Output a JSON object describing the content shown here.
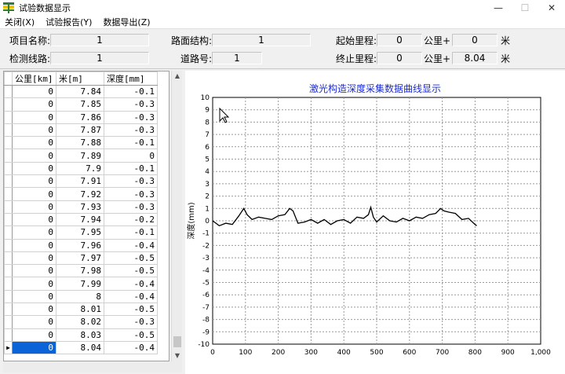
{
  "window": {
    "title": "试验数据显示",
    "minimize": "—",
    "maximize": "☐",
    "close": "✕"
  },
  "menu": [
    "关闭(X)",
    "试验报告(Y)",
    "数据导出(Z)"
  ],
  "info": {
    "project_name_label": "项目名称:",
    "project_name": "1",
    "line_label": "检测线路:",
    "line": "1",
    "pavement_label": "路面结构:",
    "pavement": "1",
    "lane_label": "道路号:",
    "lane": "1",
    "start_label": "起始里程:",
    "start_km": "0",
    "km_unit": "公里+",
    "start_m": "0",
    "m_unit": "米",
    "end_label": "终止里程:",
    "end_km": "0",
    "end_m": "8.04"
  },
  "table": {
    "headers": [
      "公里[km]",
      "米[m]",
      "深度[mm]"
    ],
    "rows": [
      [
        "0",
        "7.84",
        "-0.1"
      ],
      [
        "0",
        "7.85",
        "-0.3"
      ],
      [
        "0",
        "7.86",
        "-0.3"
      ],
      [
        "0",
        "7.87",
        "-0.3"
      ],
      [
        "0",
        "7.88",
        "-0.1"
      ],
      [
        "0",
        "7.89",
        "0"
      ],
      [
        "0",
        "7.9",
        "-0.1"
      ],
      [
        "0",
        "7.91",
        "-0.3"
      ],
      [
        "0",
        "7.92",
        "-0.3"
      ],
      [
        "0",
        "7.93",
        "-0.3"
      ],
      [
        "0",
        "7.94",
        "-0.2"
      ],
      [
        "0",
        "7.95",
        "-0.1"
      ],
      [
        "0",
        "7.96",
        "-0.4"
      ],
      [
        "0",
        "7.97",
        "-0.5"
      ],
      [
        "0",
        "7.98",
        "-0.5"
      ],
      [
        "0",
        "7.99",
        "-0.4"
      ],
      [
        "0",
        "8",
        "-0.4"
      ],
      [
        "0",
        "8.01",
        "-0.5"
      ],
      [
        "0",
        "8.02",
        "-0.3"
      ],
      [
        "0",
        "8.03",
        "-0.5"
      ],
      [
        "0",
        "8.04",
        "-0.4"
      ]
    ],
    "selected_row": 20,
    "row_marker": "▶"
  },
  "chart_data": {
    "type": "line",
    "title": "激光构造深度采集数据曲线显示",
    "ylabel": "深度(mm)",
    "xlabel": "",
    "xlim": [
      0,
      1000
    ],
    "ylim": [
      -10,
      10
    ],
    "xticks": [
      "0",
      "100",
      "200",
      "300",
      "400",
      "500",
      "600",
      "700",
      "800",
      "900",
      "1,000"
    ],
    "yticks": [
      "10",
      "9",
      "8",
      "7",
      "6",
      "5",
      "4",
      "3",
      "2",
      "1",
      "0",
      "-1",
      "-2",
      "-3",
      "-4",
      "-5",
      "-6",
      "-7",
      "-8",
      "-9",
      "-10"
    ],
    "grid": true,
    "line_color": "#000000",
    "series": [
      {
        "x": [
          0,
          20,
          40,
          60,
          80,
          95,
          105,
          120,
          140,
          160,
          180,
          200,
          220,
          235,
          245,
          260,
          280,
          300,
          320,
          340,
          360,
          380,
          400,
          420,
          440,
          460,
          475,
          482,
          490,
          500,
          520,
          540,
          560,
          580,
          600,
          620,
          640,
          660,
          680,
          695,
          705,
          720,
          740,
          760,
          780,
          800,
          805
        ],
        "y": [
          0,
          -0.4,
          -0.2,
          -0.3,
          0.4,
          1.0,
          0.5,
          0.1,
          0.3,
          0.2,
          0.1,
          0.4,
          0.5,
          1.0,
          0.8,
          -0.2,
          -0.1,
          0.1,
          -0.2,
          0.1,
          -0.3,
          0.0,
          0.1,
          -0.2,
          0.3,
          0.2,
          0.5,
          1.1,
          0.3,
          -0.1,
          0.4,
          0.0,
          -0.1,
          0.2,
          0.0,
          0.3,
          0.2,
          0.5,
          0.6,
          1.0,
          0.8,
          0.7,
          0.6,
          0.1,
          0.2,
          -0.3,
          -0.4
        ]
      }
    ]
  }
}
